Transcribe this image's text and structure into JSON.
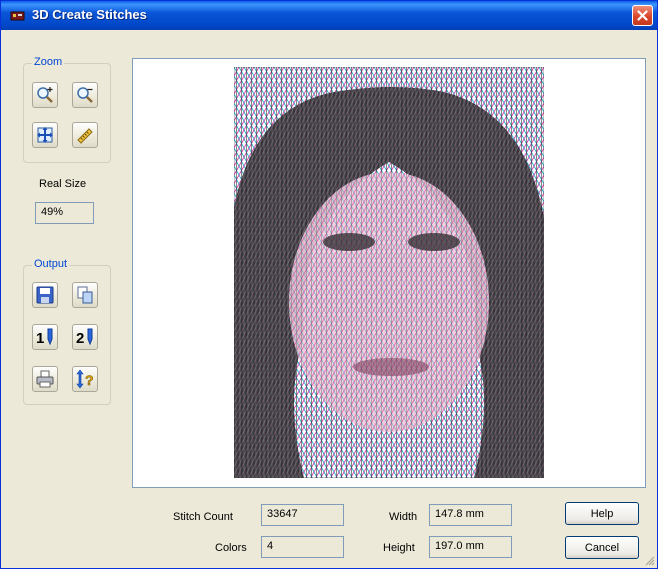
{
  "window": {
    "title": "3D Create Stitches",
    "close_icon": "close-icon"
  },
  "zoom": {
    "label": "Zoom",
    "buttons": [
      "zoom-in-icon",
      "zoom-out-icon",
      "fit-to-window-icon",
      "ruler-icon"
    ]
  },
  "real_size": {
    "label": "Real Size",
    "value": "49%"
  },
  "output": {
    "label": "Output",
    "buttons": [
      "save-icon",
      "copy-icon",
      "stitch-one-icon",
      "stitch-two-icon",
      "print-icon",
      "help-stitch-icon"
    ]
  },
  "stats": {
    "stitch_count_label": "Stitch Count",
    "stitch_count": "33647",
    "colors_label": "Colors",
    "colors": "4",
    "width_label": "Width",
    "width": "147.8 mm",
    "height_label": "Height",
    "height": "197.0 mm"
  },
  "buttons": {
    "help": "Help",
    "cancel": "Cancel"
  },
  "colors": {
    "titlebar": "#0054e3",
    "face": "#ece9d8",
    "accent_label": "#0046d5"
  }
}
